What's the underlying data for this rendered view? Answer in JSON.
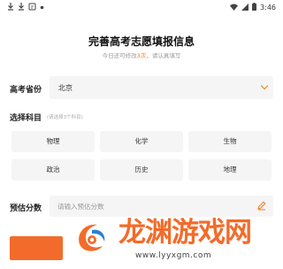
{
  "status_bar": {
    "left_icons": [
      "download-icon",
      "download-icon",
      "notification-icon",
      "app-icon"
    ],
    "time": "3:46",
    "right_icons": [
      "wifi-icon",
      "signal-icon",
      "battery-icon"
    ]
  },
  "header": {
    "title": "完善高考志愿填报信息",
    "subtitle_prefix": "今日还可修改",
    "subtitle_count": "3次",
    "subtitle_suffix": "，请认真填写"
  },
  "form": {
    "province_label": "高考省份",
    "province_value": "北京",
    "subjects_label": "选择科目",
    "subjects_hint": "(请选择3个科目)",
    "subjects": [
      "物理",
      "化学",
      "生物",
      "政治",
      "历史",
      "地理"
    ],
    "score_label": "预估分数",
    "score_placeholder": "请输入预估分数"
  },
  "watermark": {
    "text": "龙渊游戏网",
    "url": "www.lyyxgm.com"
  },
  "colors": {
    "accent": "#f07a1a",
    "field_bg": "#f5f5f5",
    "button": "#f36b2a"
  }
}
